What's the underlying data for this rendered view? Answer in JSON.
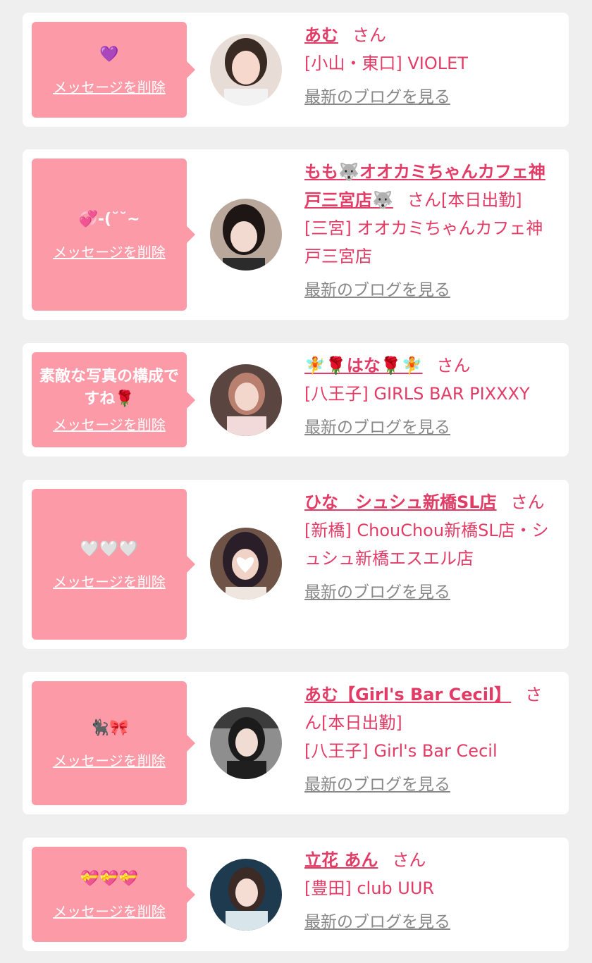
{
  "common": {
    "delete_label": "メッセージを削除",
    "blog_label": "最新のブログを見る",
    "san": "さん"
  },
  "colors": {
    "background": "#efefef",
    "card": "#ffffff",
    "bubble": "#fd9aa7",
    "accent": "#e23c66",
    "muted": "#888888"
  },
  "messages": [
    {
      "message": "💜",
      "name": "あむ",
      "status": "",
      "shop": "[小山・東口] VIOLET",
      "avatar_icon": "avatar-photo"
    },
    {
      "message": "💞-(˘˘~",
      "name": "もも🐺オオカミちゃんカフェ神戸三宮店🐺",
      "status": "[本日出勤]",
      "shop": "[三宮] オオカミちゃんカフェ神戸三宮店",
      "avatar_icon": "avatar-photo"
    },
    {
      "message": "素敵な写真の構成ですね🌹",
      "name": "🧚🌹はな🌹🧚",
      "status": "",
      "shop": "[八王子] GIRLS BAR PIXXXY",
      "avatar_icon": "avatar-photo"
    },
    {
      "message": "🤍🤍🤍",
      "name": "ひな　シュシュ新橋SL店",
      "status": "",
      "shop": "[新橋] ChouChou新橋SL店・シュシュ新橋エスエル店",
      "avatar_icon": "avatar-photo"
    },
    {
      "message": "🐈‍⬛🎀",
      "name": "あむ【Girl's Bar Cecil】",
      "status": "[本日出勤]",
      "shop": "[八王子] Girl's Bar Cecil",
      "avatar_icon": "avatar-photo"
    },
    {
      "message": "💝💝💝",
      "name": "立花 あん",
      "status": "",
      "shop": "[豊田] club UUR",
      "avatar_icon": "avatar-photo"
    }
  ]
}
